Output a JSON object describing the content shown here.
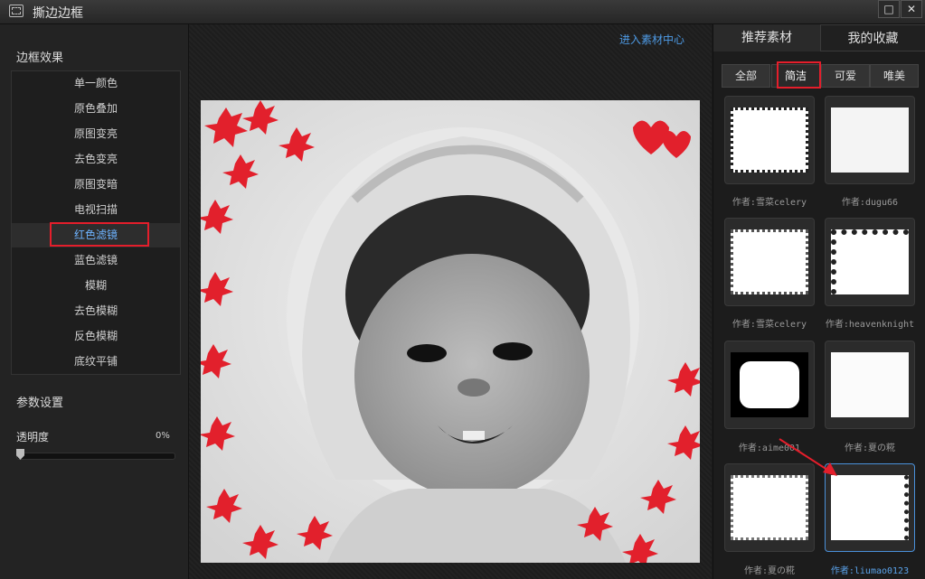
{
  "window": {
    "title": "撕边边框",
    "maximize_icon": "□",
    "close_icon": "✕"
  },
  "left_panel": {
    "effects_title": "边框效果",
    "effects": [
      "单一颜色",
      "原色叠加",
      "原图变亮",
      "去色变亮",
      "原图变暗",
      "电视扫描",
      "红色滤镜",
      "蓝色滤镜",
      "模糊",
      "去色模糊",
      "反色模糊",
      "底纹平铺"
    ],
    "selected_effect": "红色滤镜",
    "params_title": "参数设置",
    "opacity_label": "透明度",
    "opacity_value": "0%",
    "opacity_level": 0
  },
  "center": {
    "material_center_link": "进入素材中心"
  },
  "right_panel": {
    "tabs": {
      "recommended": "推荐素材",
      "favorites": "我的收藏"
    },
    "subtabs": {
      "all": "全部",
      "simple": "简洁",
      "cute": "可爱",
      "beautiful": "唯美"
    },
    "selected_subtab": "简洁",
    "thumbs": [
      {
        "caption": "作者:雪菜celery"
      },
      {
        "caption": "作者:dugu66"
      },
      {
        "caption": "作者:雪菜celery"
      },
      {
        "caption": "作者:heavenknight"
      },
      {
        "caption": "作者:aime001"
      },
      {
        "caption": "作者:夏の糀"
      },
      {
        "caption": "作者:夏の糀"
      },
      {
        "caption": "作者:liumao0123"
      }
    ]
  },
  "colors": {
    "highlight_red": "#e41e2b",
    "link_blue": "#4e9be6",
    "selected_blue": "#6db3ff"
  }
}
